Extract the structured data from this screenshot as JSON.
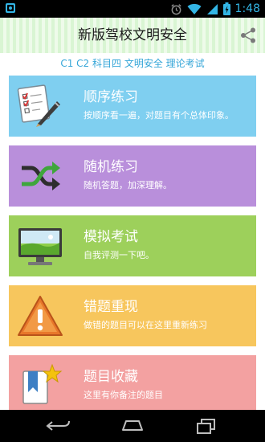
{
  "status_bar": {
    "time": "1:48",
    "icons": [
      "alarm-icon",
      "wifi-icon",
      "signal-icon",
      "battery-charging-icon"
    ],
    "accent": "#33b5e5"
  },
  "app_bar": {
    "title": "新版驾校文明安全",
    "share_icon": "share-icon"
  },
  "subtitle": "C1 C2 科目四 文明安全 理论考试",
  "cards": [
    {
      "title": "顺序练习",
      "desc": "按顺序看一遍，对题目有个总体印象。",
      "icon": "checklist-pen-icon",
      "color": "#7fcff0"
    },
    {
      "title": "随机练习",
      "desc": "随机答题，加深理解。",
      "icon": "shuffle-icon",
      "color": "#b98fdb"
    },
    {
      "title": "模拟考试",
      "desc": "自我评测一下吧。",
      "icon": "monitor-icon",
      "color": "#9dd05b"
    },
    {
      "title": "错题重现",
      "desc": "做错的题目可以在这里重新练习",
      "icon": "warning-icon",
      "color": "#f7c65d"
    },
    {
      "title": "题目收藏",
      "desc": "这里有你备注的题目",
      "icon": "bookmark-star-icon",
      "color": "#f3a1a1"
    }
  ],
  "nav_bar": {
    "buttons": [
      "back-icon",
      "home-icon",
      "recent-apps-icon"
    ]
  }
}
